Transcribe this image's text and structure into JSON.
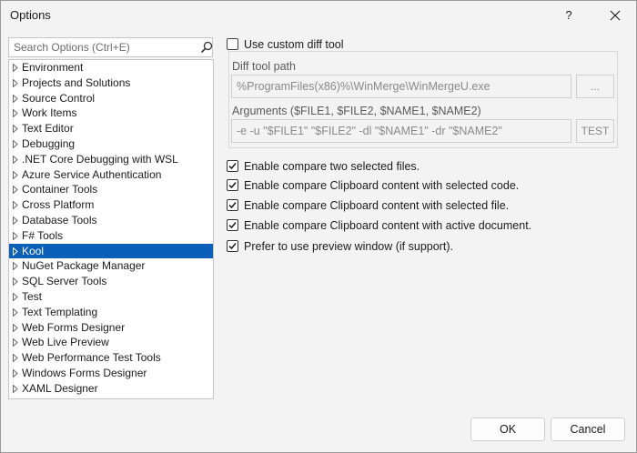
{
  "window": {
    "title": "Options",
    "help_label": "?"
  },
  "search": {
    "placeholder": "Search Options (Ctrl+E)",
    "value": ""
  },
  "tree": {
    "items": [
      {
        "label": "Environment"
      },
      {
        "label": "Projects and Solutions"
      },
      {
        "label": "Source Control"
      },
      {
        "label": "Work Items"
      },
      {
        "label": "Text Editor"
      },
      {
        "label": "Debugging"
      },
      {
        "label": ".NET Core Debugging with WSL"
      },
      {
        "label": "Azure Service Authentication"
      },
      {
        "label": "Container Tools"
      },
      {
        "label": "Cross Platform"
      },
      {
        "label": "Database Tools"
      },
      {
        "label": "F# Tools"
      },
      {
        "label": "Kool",
        "selected": true
      },
      {
        "label": "NuGet Package Manager"
      },
      {
        "label": "SQL Server Tools"
      },
      {
        "label": "Test"
      },
      {
        "label": "Text Templating"
      },
      {
        "label": "Web Forms Designer"
      },
      {
        "label": "Web Live Preview"
      },
      {
        "label": "Web Performance Test Tools"
      },
      {
        "label": "Windows Forms Designer"
      },
      {
        "label": "XAML Designer"
      }
    ]
  },
  "diff": {
    "use_custom_label": "Use custom diff tool",
    "use_custom_checked": false,
    "path_label": "Diff tool path",
    "path_value": "%ProgramFiles(x86)%\\WinMerge\\WinMergeU.exe",
    "browse_label": "...",
    "args_label": "Arguments ($FILE1, $FILE2, $NAME1, $NAME2)",
    "args_value": "-e -u \"$FILE1\" \"$FILE2\" -dl \"$NAME1\" -dr \"$NAME2\"",
    "test_label": "TEST"
  },
  "options": [
    {
      "label": "Enable compare two selected files.",
      "checked": true
    },
    {
      "label": "Enable compare Clipboard content with selected code.",
      "checked": true
    },
    {
      "label": "Enable compare Clipboard content with selected file.",
      "checked": true
    },
    {
      "label": "Enable compare Clipboard content with active document.",
      "checked": true
    },
    {
      "label": "Prefer to use preview window (if support).",
      "checked": true
    }
  ],
  "buttons": {
    "ok": "OK",
    "cancel": "Cancel"
  },
  "colors": {
    "selection": "#0a5fb8",
    "background": "#f3f3f3"
  },
  "icons": {
    "search": "search-icon",
    "close": "close-icon",
    "expand": "chevron-right-icon",
    "check": "check-icon"
  }
}
